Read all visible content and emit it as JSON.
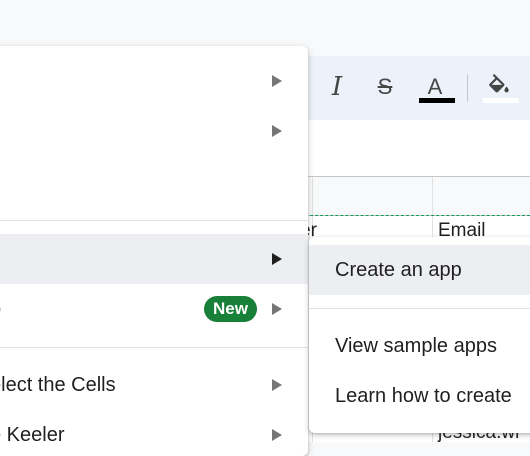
{
  "toolbar": {
    "italic_glyph": "I",
    "strikethrough_glyph": "S",
    "text_color_glyph": "A",
    "text_color_value": "#000000",
    "fill_color_value": "#ffffff"
  },
  "grid": {
    "cells": [
      {
        "text": "er"
      },
      {
        "text": "Email"
      },
      {
        "text": "jessica.wi"
      }
    ]
  },
  "menu": {
    "items": [
      {
        "label": "",
        "has_submenu": true
      },
      {
        "label": "",
        "has_submenu": true
      },
      {
        "label": "",
        "has_submenu": true,
        "active": true
      },
      {
        "label": "p",
        "badge": "New",
        "has_submenu": true
      },
      {
        "label": "elect the Cells",
        "has_submenu": true
      },
      {
        "label": "e Keeler",
        "has_submenu": true
      }
    ]
  },
  "submenu": {
    "items": [
      {
        "label": "Create an app",
        "active": true
      },
      {
        "label": "View sample apps"
      },
      {
        "label": "Learn how to create"
      }
    ]
  },
  "colors": {
    "menu_bg": "#ffffff",
    "hover_bg": "#eceef1",
    "badge_bg": "#188038",
    "toolbar_bg": "#edf2fa",
    "selection_dash": "#0f9d58"
  }
}
